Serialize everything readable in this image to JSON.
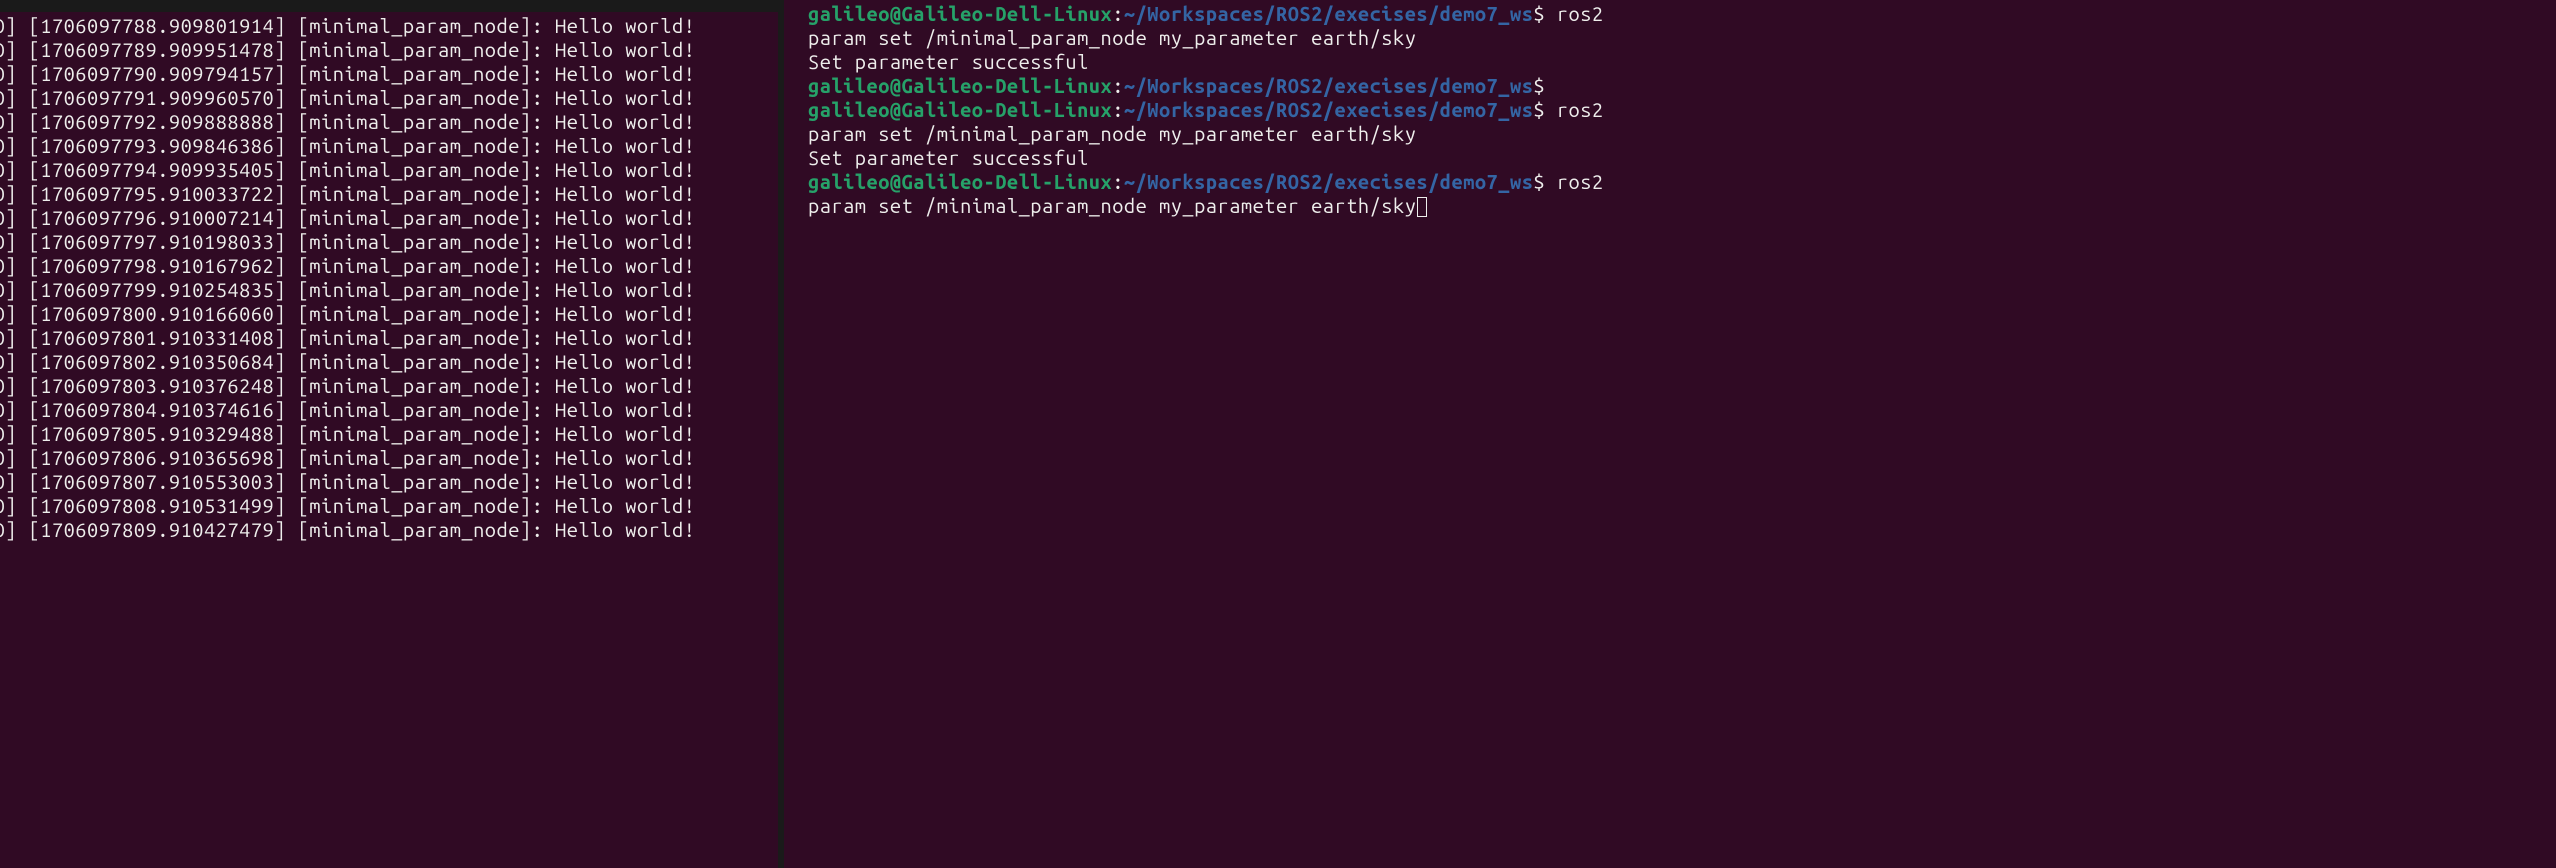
{
  "colors": {
    "bg": "#300a24",
    "fg": "#eeeeec",
    "user_host": "#26a269",
    "path": "#3465a4"
  },
  "left_terminal": {
    "node_name": "[minimal_param_node]",
    "message": "Hello world!",
    "level": "NFO]",
    "lines": [
      {
        "timestamp": "[1706097788.909801914]"
      },
      {
        "timestamp": "[1706097789.909951478]"
      },
      {
        "timestamp": "[1706097790.909794157]"
      },
      {
        "timestamp": "[1706097791.909960570]"
      },
      {
        "timestamp": "[1706097792.909888888]"
      },
      {
        "timestamp": "[1706097793.909846386]"
      },
      {
        "timestamp": "[1706097794.909935405]"
      },
      {
        "timestamp": "[1706097795.910033722]"
      },
      {
        "timestamp": "[1706097796.910007214]"
      },
      {
        "timestamp": "[1706097797.910198033]"
      },
      {
        "timestamp": "[1706097798.910167962]"
      },
      {
        "timestamp": "[1706097799.910254835]"
      },
      {
        "timestamp": "[1706097800.910166060]"
      },
      {
        "timestamp": "[1706097801.910331408]"
      },
      {
        "timestamp": "[1706097802.910350684]"
      },
      {
        "timestamp": "[1706097803.910376248]"
      },
      {
        "timestamp": "[1706097804.910374616]"
      },
      {
        "timestamp": "[1706097805.910329488]"
      },
      {
        "timestamp": "[1706097806.910365698]"
      },
      {
        "timestamp": "[1706097807.910553003]"
      },
      {
        "timestamp": "[1706097808.910531499]"
      },
      {
        "timestamp": "[1706097809.910427479]"
      }
    ]
  },
  "right_terminal": {
    "prompt": {
      "user_host": "galileo@Galileo-Dell-Linux",
      "colon": ":",
      "path": "~/Workspaces/ROS2/execises/demo7_ws",
      "dollar": "$"
    },
    "entries": [
      {
        "type": "prompt_cmd",
        "cmd": "ros2"
      },
      {
        "type": "continuation",
        "text": "param set /minimal_param_node my_parameter earth/sky"
      },
      {
        "type": "output",
        "text": "Set parameter successful"
      },
      {
        "type": "prompt_only"
      },
      {
        "type": "prompt_cmd",
        "cmd": "ros2"
      },
      {
        "type": "continuation",
        "text": "param set /minimal_param_node my_parameter earth/sky"
      },
      {
        "type": "output",
        "text": "Set parameter successful"
      },
      {
        "type": "prompt_cmd",
        "cmd": "ros2"
      },
      {
        "type": "continuation_cursor",
        "text": "param set /minimal_param_node my_parameter earth/sky"
      }
    ]
  }
}
